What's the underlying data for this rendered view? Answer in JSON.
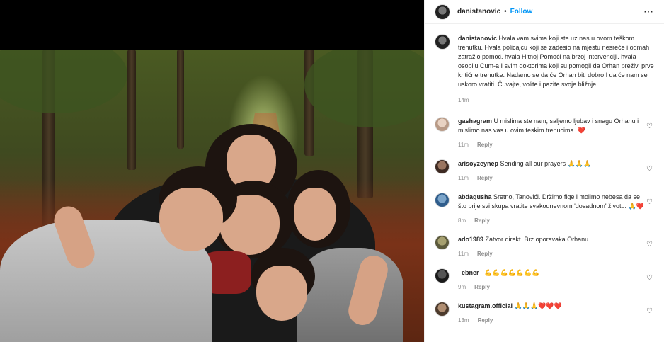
{
  "post": {
    "username": "danistanovic",
    "follow_label": "Follow",
    "separator": "•",
    "more_icon": "⋯"
  },
  "caption": {
    "username": "danistanovic",
    "text": "Hvala vam svima koji ste uz nas u ovom teškom trenutku. Hvala policajcu koji se zadesio na mjestu nesreće i odmah zatražio pomoć. hvala Hitnoj Pomoći na brzoj intervenciji. hvala osoblju Cum-a I svim doktorima koji su pomogli da Orhan preživi prve kritične trenutke. Nadamo se da će Orhan biti dobro I da će nam se uskoro vratiti. Čuvajte, volite i pazite svoje bližnje.",
    "time": "14m"
  },
  "comments": [
    {
      "username": "gashagram",
      "text": "U mislima ste nam, saljemo ljubav i snagu Orhanu i mislimo nas vas u ovim teskim trenucima. ❤️",
      "time": "11m",
      "reply": "Reply"
    },
    {
      "username": "arisoyzeynep",
      "text": "Sending all our prayers 🙏🙏🙏",
      "time": "11m",
      "reply": "Reply"
    },
    {
      "username": "abdagusha",
      "text": "Sretno, Tanovići. Držimo fige i molimo nebesa da se što prije svi skupa vratite svakodnevnom 'dosadnom' životu. 🙏❤️",
      "time": "8m",
      "reply": "Reply"
    },
    {
      "username": "ado1989",
      "text": "Zatvor direkt. Brz oporavaka Orhanu",
      "time": "11m",
      "reply": "Reply"
    },
    {
      "username": "_ebner_",
      "text": "💪💪💪💪💪💪💪",
      "time": "9m",
      "reply": "Reply"
    },
    {
      "username": "kustagram.official",
      "text": "🙏🙏🙏❤️❤️❤️",
      "time": "13m",
      "reply": "Reply"
    }
  ],
  "icons": {
    "heart": "♡"
  }
}
